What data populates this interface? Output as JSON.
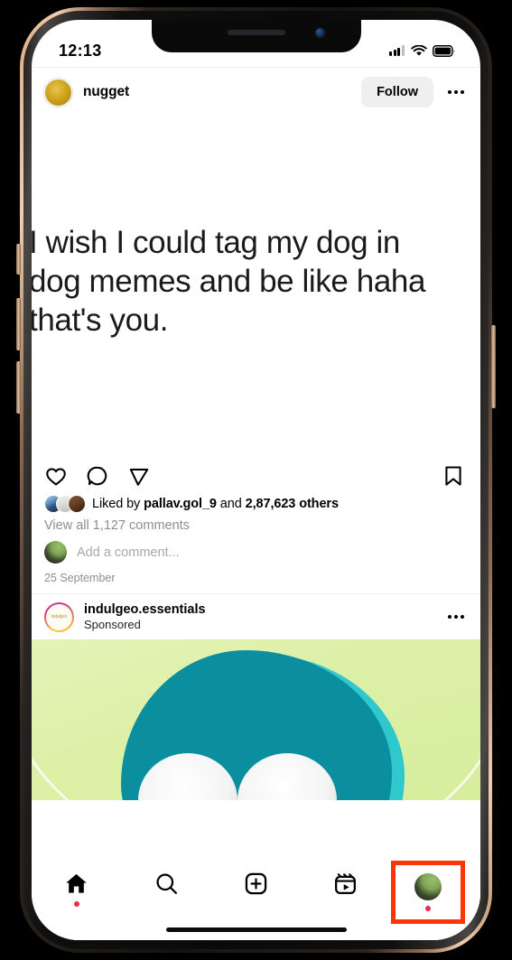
{
  "device": {
    "status_bar": {
      "time": "12:13",
      "signal_icon": "cellular-signal-icon",
      "wifi_icon": "wifi-icon",
      "battery_icon": "battery-icon"
    },
    "notch": {
      "speaker_icon": "speaker-grille-icon",
      "camera_icon": "front-camera-icon"
    },
    "home_indicator": "home-indicator"
  },
  "feed": {
    "post": {
      "username": "nugget",
      "avatar_icon": "nugget-avatar",
      "follow_label": "Follow",
      "more_icon": "more-options-icon",
      "image_text_lines": [
        "I wish I could tag my dog in",
        "dog memes and be like haha",
        "that's you."
      ],
      "actions": {
        "like_icon": "heart-icon",
        "comment_icon": "comment-bubble-icon",
        "share_icon": "share-paper-plane-icon",
        "save_icon": "bookmark-icon"
      },
      "likes_prefix": "Liked by ",
      "likes_username": "pallav.gol_9",
      "likes_middle": " and ",
      "likes_count": "2,87,623 others",
      "view_comments": "View all 1,127 comments",
      "add_comment_placeholder": "Add a comment...",
      "timestamp": "25 September"
    },
    "sponsored_post": {
      "username": "indulgeo.essentials",
      "label": "Sponsored",
      "avatar_brand_text": "indulgeo",
      "more_icon": "more-options-icon"
    }
  },
  "bottom_nav": {
    "items": [
      {
        "name": "home",
        "icon": "home-icon",
        "active": true,
        "has_dot": true
      },
      {
        "name": "search",
        "icon": "search-magnifier-icon",
        "active": false,
        "has_dot": false
      },
      {
        "name": "create",
        "icon": "create-plus-box-icon",
        "active": false,
        "has_dot": false
      },
      {
        "name": "reels",
        "icon": "reels-clapperboard-icon",
        "active": false,
        "has_dot": false
      },
      {
        "name": "profile",
        "icon": "profile-avatar-icon",
        "active": false,
        "has_dot": true
      }
    ],
    "highlight_color": "#FC3605",
    "notification_dot_color": "#ED2A50"
  }
}
